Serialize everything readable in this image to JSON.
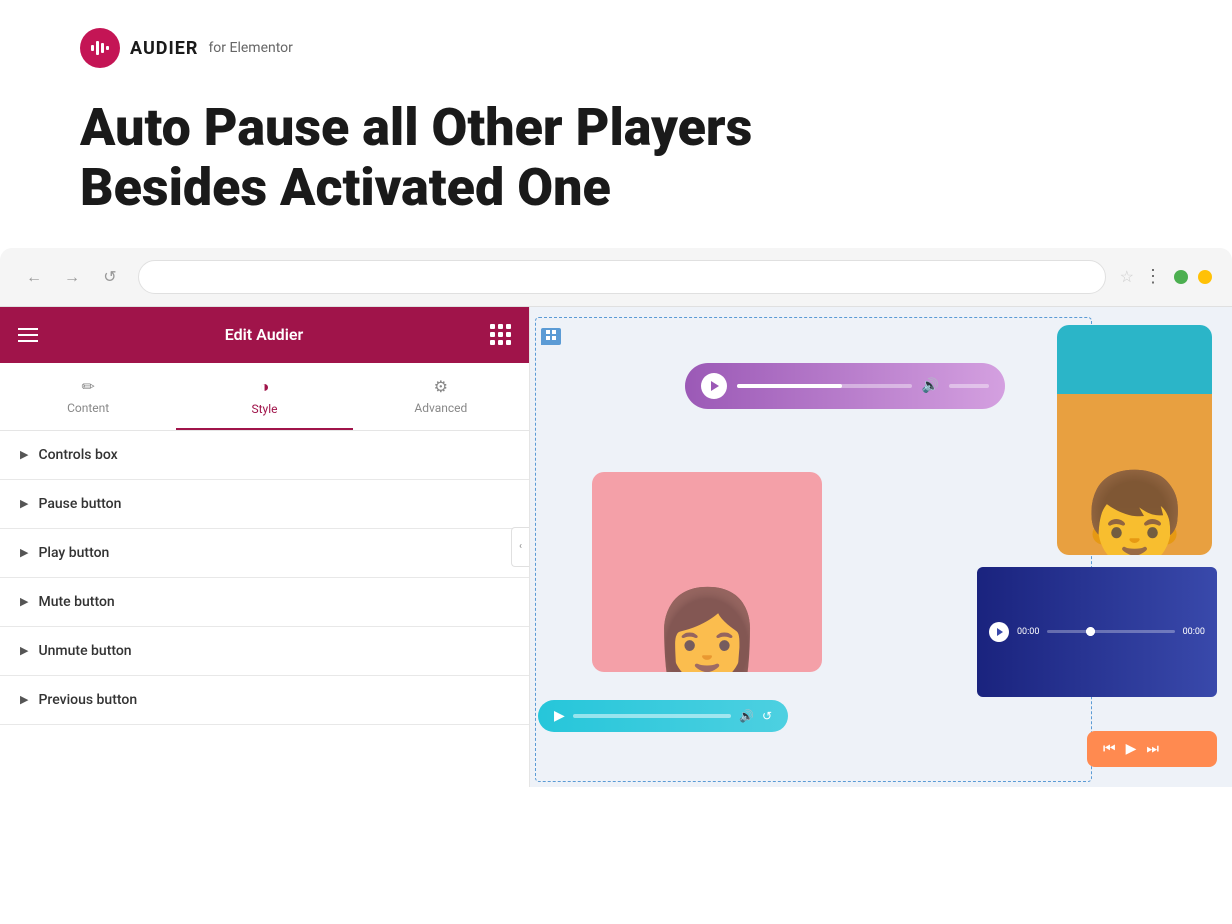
{
  "brand": {
    "name": "AUDIER",
    "sub": "for Elementor"
  },
  "main_title": {
    "line1": "Auto Pause all Other Players",
    "line2": "Besides Activated One"
  },
  "browser": {
    "url_placeholder": "",
    "nav": {
      "back": "←",
      "forward": "→",
      "refresh": "↺"
    }
  },
  "sidebar": {
    "title": "Edit Audier",
    "tabs": [
      {
        "label": "Content",
        "icon": "✏️",
        "active": false
      },
      {
        "label": "Style",
        "icon": "◑",
        "active": true
      },
      {
        "label": "Advanced",
        "icon": "⚙",
        "active": false
      }
    ],
    "accordion_items": [
      {
        "label": "Controls box"
      },
      {
        "label": "Pause button"
      },
      {
        "label": "Play button"
      },
      {
        "label": "Mute button"
      },
      {
        "label": "Unmute button"
      },
      {
        "label": "Previous button"
      }
    ]
  },
  "colors": {
    "brand_primary": "#a0144a",
    "brand_logo_bg": "#c41555",
    "tab_active_border": "#a0144a",
    "sidebar_header_bg": "#a0144a"
  }
}
